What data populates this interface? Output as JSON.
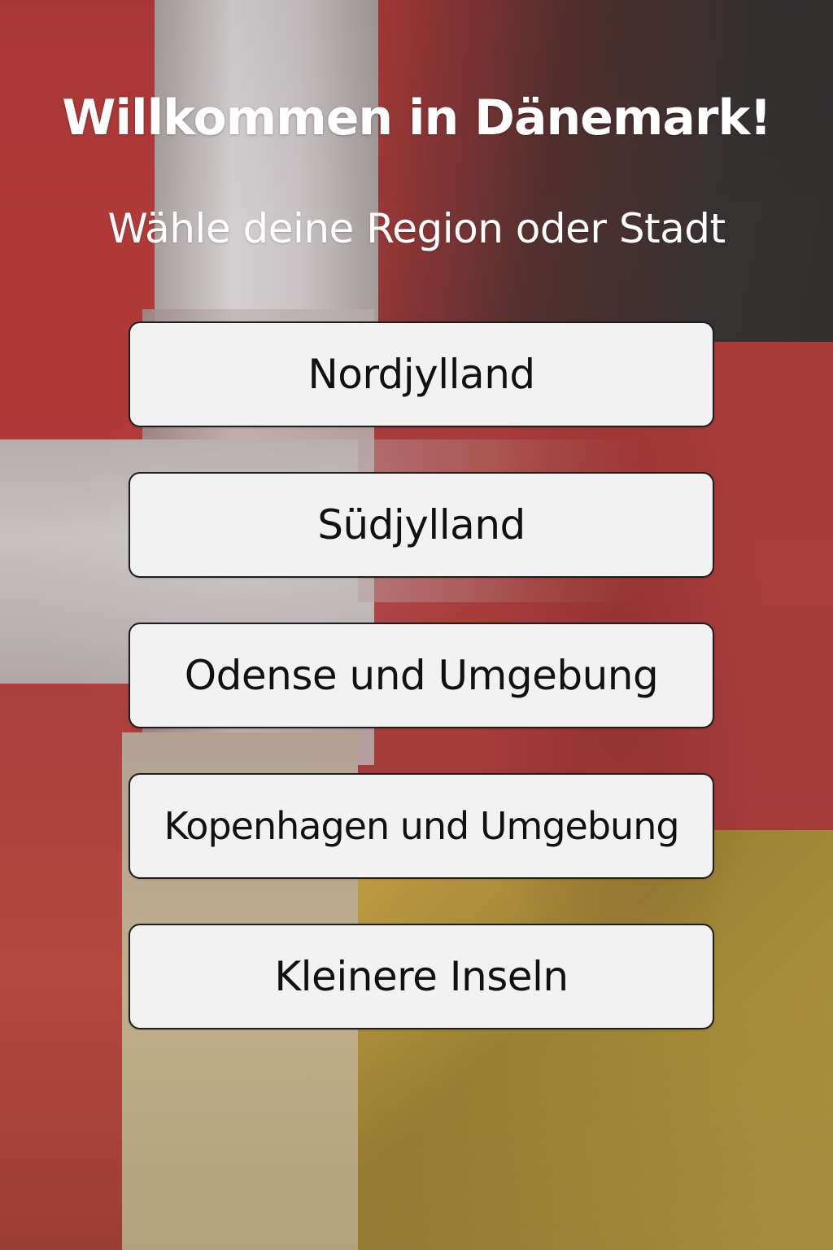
{
  "header": {
    "title": "Willkommen in Dänemark!",
    "subtitle": "Wähle deine Region oder Stadt"
  },
  "regions": [
    {
      "label": "Nordjylland"
    },
    {
      "label": "Südjylland"
    },
    {
      "label": "Odense und Umgebung"
    },
    {
      "label": "Kopenhagen und Umgebung"
    },
    {
      "label": "Kleinere Inseln"
    }
  ],
  "theme": {
    "danish_red": "#b03a38",
    "cross_white": "#d4cfd0",
    "german_black": "#333030",
    "german_gold": "#a88d3a",
    "button_bg": "#f2f2f2",
    "button_border": "#1e1e1e"
  }
}
